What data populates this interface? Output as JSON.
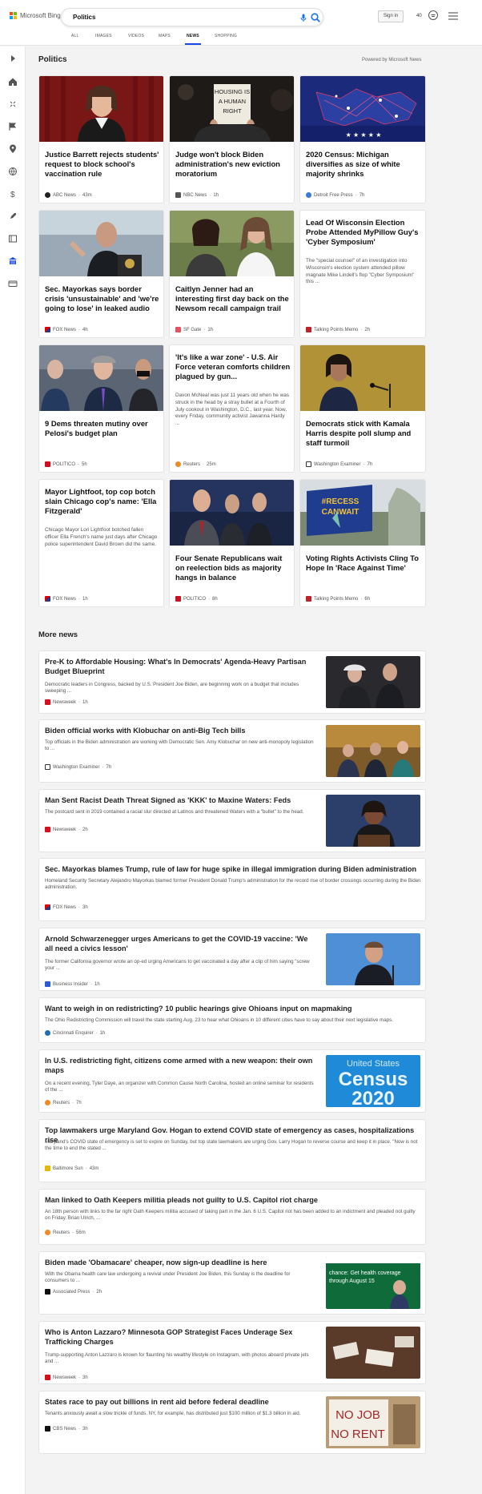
{
  "header": {
    "brand": "Microsoft Bing",
    "query": "Politics",
    "signin": "Sign in",
    "points": "40"
  },
  "tabs": [
    "ALL",
    "IMAGES",
    "VIDEOS",
    "MAPS",
    "NEWS",
    "SHOPPING"
  ],
  "active_tab": "NEWS",
  "politics": {
    "title": "Politics",
    "powered": "Powered by Microsoft News"
  },
  "cards": [
    {
      "title": "Justice Barrett rejects students' request to block school's vaccination rule",
      "source": "ABC News",
      "time": "43m",
      "snippet": ""
    },
    {
      "title": "Judge won't block Biden administration's new eviction moratorium",
      "source": "NBC News",
      "time": "1h",
      "snippet": ""
    },
    {
      "title": "2020 Census: Michigan diversifies as size of white majority shrinks",
      "source": "Detroit Free Press",
      "time": "7h",
      "snippet": ""
    },
    {
      "title": "Sec. Mayorkas says border crisis 'unsustainable' and 'we're going to lose' in leaked audio",
      "source": "FOX News",
      "time": "4h",
      "snippet": ""
    },
    {
      "title": "Caitlyn Jenner had an interesting first day back on the Newsom recall campaign trail",
      "source": "SF Gate",
      "time": "1h",
      "snippet": ""
    },
    {
      "title": "Lead Of Wisconsin Election Probe Attended MyPillow Guy's 'Cyber Symposium'",
      "source": "Talking Points Memo",
      "time": "2h",
      "snippet": "The \"special counsel\" of an investigation into Wisconsin's election system attended pillow magnate Mike Lindell's flop \"Cyber Symposium\" this ..."
    },
    {
      "title": "9 Dems threaten mutiny over Pelosi's budget plan",
      "source": "POLITICO",
      "time": "5h",
      "snippet": ""
    },
    {
      "title": "'It's like a war zone' - U.S. Air Force veteran comforts children plagued by gun...",
      "source": "Reuters",
      "time": "25m",
      "snippet": "Davon McNeal was just 11 years old when he was struck in the head by a stray bullet at a Fourth of July cookout in Washington, D.C., last year. Now, every Friday, community activist Jawanna Hardy ..."
    },
    {
      "title": "Democrats stick with Kamala Harris despite poll slump and staff turmoil",
      "source": "Washington Examiner",
      "time": "7h",
      "snippet": ""
    },
    {
      "title": "Mayor Lightfoot, top cop botch slain Chicago cop's name: 'Ella Fitzgerald'",
      "source": "FOX News",
      "time": "1h",
      "snippet": "Chicago Mayor Lori Lightfoot botched fallen officer Ella French's name just days after Chicago police superintendent David Brown did the same."
    },
    {
      "title": "Four Senate Republicans wait on reelection bids as majority hangs in balance",
      "source": "POLITICO",
      "time": "8h",
      "snippet": ""
    },
    {
      "title": "Voting Rights Activists Cling To Hope In 'Race Against Time'",
      "source": "Talking Points Memo",
      "time": "6h",
      "snippet": ""
    }
  ],
  "more_news": {
    "title": "More news",
    "items": [
      {
        "title": "Pre-K to Affordable Housing: What's In Democrats' Agenda-Heavy Partisan Budget Blueprint",
        "snippet": "Democratic leaders in Congress, backed by U.S. President Joe Biden, are beginning work on a budget that includes sweeping ...",
        "source": "Newsweek",
        "time": "1h"
      },
      {
        "title": "Biden official works with Klobuchar on anti-Big Tech bills",
        "snippet": "Top officials in the Biden administration are working with Democratic Sen. Amy Klobuchar on new anti-monopoly legislation to ...",
        "source": "Washington Examiner",
        "time": "7h"
      },
      {
        "title": "Man Sent Racist Death Threat Signed as 'KKK' to Maxine Waters: Feds",
        "snippet": "The postcard sent in 2019 contained a racial slur directed at Latinos and threatened Waters with a \"bullet\" to the head.",
        "source": "Newsweek",
        "time": "2h"
      },
      {
        "title": "Sec. Mayorkas blames Trump, rule of law for huge spike in illegal immigration during Biden administration",
        "snippet": "Homeland Security Secretary Alejandro Mayorkas blamed former President Donald Trump's administration for the record rise of border crossings occurring during the Biden administration.",
        "source": "FOX News",
        "time": "3h"
      },
      {
        "title": "Arnold Schwarzenegger urges Americans to get the COVID-19 vaccine: 'We all need a civics lesson'",
        "snippet": "The former California governor wrote an op-ed urging Americans to get vaccinated a day after a clip of him saying \"screw your ...",
        "source": "Business Insider",
        "time": "1h"
      },
      {
        "title": "Want to weigh in on redistricting? 10 public hearings give Ohioans input on mapmaking",
        "snippet": "The Ohio Redistricting Commission will travel the state starting Aug. 23 to hear what Ohioans in 10 different cities have to say about their next legislative maps.",
        "source": "Cincinnati Enquirer",
        "time": "1h"
      },
      {
        "title": "In U.S. redistricting fight, citizens come armed with a new weapon: their own maps",
        "snippet": "On a recent evening, Tyler Daye, an organizer with Common Cause North Carolina, hosted an online seminar for residents of the ...",
        "source": "Reuters",
        "time": "7h"
      },
      {
        "title": "Top lawmakers urge Maryland Gov. Hogan to extend COVID state of emergency as cases, hospitalizations rise",
        "snippet": "Maryland's COVID state of emergency is set to expire on Sunday, but top state lawmakers are urging Gov. Larry Hogan to reverse course and keep it in place. \"Now is not the time to end the stated ...",
        "source": "Baltimore Sun",
        "time": "43m"
      },
      {
        "title": "Man linked to Oath Keepers militia pleads not guilty to U.S. Capitol riot charge",
        "snippet": "An 18th person with links to the far right Oath Keepers militia accused of taking part in the Jan. 6 U.S. Capitol riot has been added to an indictment and pleaded not guilty on Friday. Brian Ulrich, ...",
        "source": "Reuters",
        "time": "56m"
      },
      {
        "title": "Biden made 'Obamacare' cheaper, now sign-up deadline is here",
        "snippet": "With the Obama health care law undergoing a revival under President Joe Biden, this Sunday is the deadline for consumers to ...",
        "source": "Associated Press",
        "time": "2h"
      },
      {
        "title": "Who is Anton Lazzaro? Minnesota GOP Strategist Faces Underage Sex Trafficking Charges",
        "snippet": "Trump-supporting Anton Lazzaro is known for flaunting his wealthy lifestyle on Instagram, with photos aboard private jets and ...",
        "source": "Newsweek",
        "time": "3h"
      },
      {
        "title": "States race to pay out billions in rent aid before federal deadline",
        "snippet": "Tenants anxiously await a slow trickle of funds. NY, for example, has distributed just $100 million of $1.3 billion in aid.",
        "source": "CBS News",
        "time": "3h"
      }
    ]
  },
  "image_text": {
    "sign": "HOUSING IS A HUMAN RIGHT",
    "recess": "#RECESS CANWAIT",
    "census1": "United States",
    "census2": "Census",
    "census3": "2020",
    "nojob": "NO JOB NO RENT",
    "obamacare": "chance: Get health coverage through August 15"
  },
  "colors": {
    "accent": "#174ae4",
    "tab_underline": "#174ae4"
  }
}
